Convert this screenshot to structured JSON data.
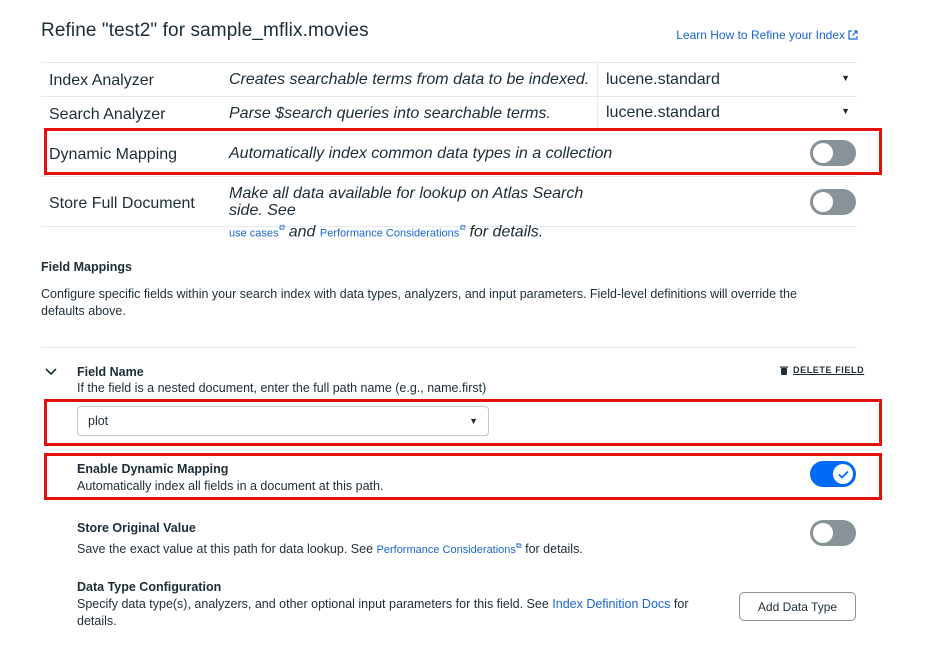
{
  "header": {
    "title": "Refine \"test2\" for sample_mflix.movies",
    "learn_link": "Learn How to Refine your Index"
  },
  "settings": {
    "index_analyzer": {
      "label": "Index Analyzer",
      "desc": "Creates searchable terms from data to be indexed.",
      "value": "lucene.standard"
    },
    "search_analyzer": {
      "label": "Search Analyzer",
      "desc": "Parse $search queries into searchable terms.",
      "value": "lucene.standard"
    },
    "dynamic_mapping": {
      "label": "Dynamic Mapping",
      "desc": "Automatically index common data types in a collection",
      "enabled": false
    },
    "store_full": {
      "label": "Store Full Document",
      "desc_1": "Make all data available for lookup on Atlas Search side. See",
      "link_1": "use cases",
      "and": "and",
      "link_2": "Performance Considerations",
      "tail": "for details.",
      "enabled": false
    }
  },
  "field_mappings": {
    "title": "Field Mappings",
    "desc": "Configure specific fields within your search index with data types, analyzers, and input parameters. Field-level definitions will override the defaults above.",
    "field_name_label": "Field Name",
    "field_name_hint": "If the field is a nested document, enter the full path name (e.g., name.first)",
    "delete_label": "DELETE FIELD",
    "field_value": "plot",
    "enable_dyn": {
      "label": "Enable Dynamic Mapping",
      "desc": "Automatically index all fields in a document at this path.",
      "enabled": true
    },
    "store_orig": {
      "label": "Store Original Value",
      "desc": "Save the exact value at this path for data lookup. See",
      "link": "Performance Considerations",
      "tail": "for details.",
      "enabled": false
    },
    "data_type": {
      "label": "Data Type Configuration",
      "desc": "Specify data type(s), analyzers, and other optional input parameters for this field. See",
      "link": "Index Definition Docs",
      "tail": "for details.",
      "button": "Add Data Type"
    }
  },
  "colors": {
    "accent": "#016bf8",
    "link": "#1a66d2",
    "highlight": "#e0100c",
    "toggle_off": "#889397"
  }
}
